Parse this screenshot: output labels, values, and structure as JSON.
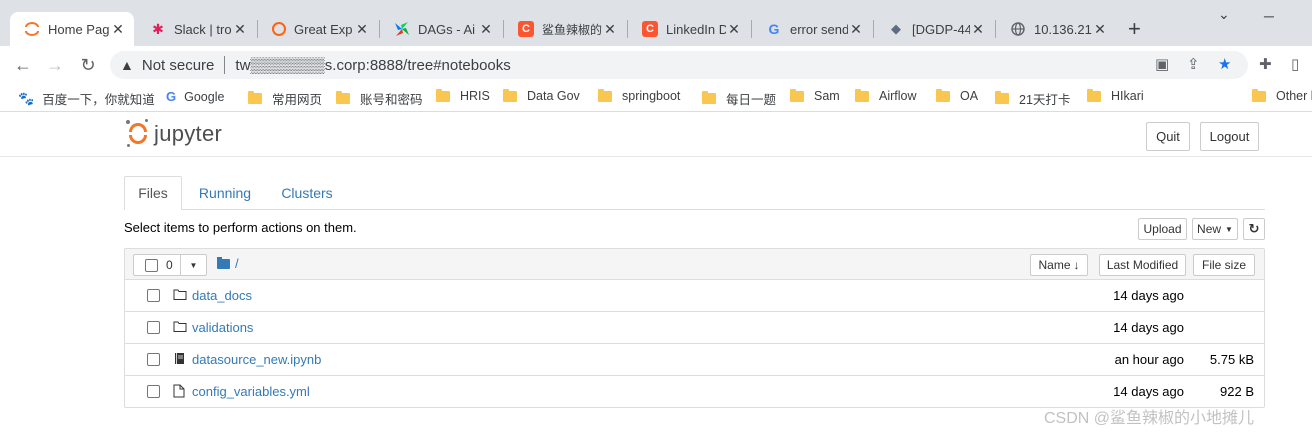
{
  "browser": {
    "tabs": [
      {
        "title": "Home Pag",
        "icon": "jupyter-icon",
        "color": "#f37726",
        "active": true
      },
      {
        "title": "Slack | tro",
        "icon": "slack-icon",
        "color": "#e01e5a",
        "active": false
      },
      {
        "title": "Great Exp",
        "icon": "great-expectations-icon",
        "color": "#ff6310",
        "active": false
      },
      {
        "title": "DAGs - Ai",
        "icon": "airflow-icon",
        "color": "#017cee",
        "active": false
      },
      {
        "title": "鲨鱼辣椒的",
        "icon": "csdn-icon",
        "color": "#fc5531",
        "active": false
      },
      {
        "title": "LinkedIn D",
        "icon": "csdn-icon",
        "color": "#fc5531",
        "active": false
      },
      {
        "title": "error send",
        "icon": "google-icon",
        "color": "#4285f4",
        "active": false
      },
      {
        "title": "[DGDP-44",
        "icon": "jira-icon",
        "color": "#5e6c84",
        "active": false
      },
      {
        "title": "10.136.21",
        "icon": "globe-icon",
        "color": "#5f6368",
        "active": false
      }
    ],
    "security_label": "Not securе",
    "url": "tw▒▒▒▒▒▒▒s.corp:8888/tree#notebooks",
    "bookmarks": [
      {
        "label": "百度一下，你就知道",
        "icon": "baidu-icon"
      },
      {
        "label": "Google",
        "icon": "google-icon"
      },
      {
        "label": "常用网页",
        "icon": "folder-icon"
      },
      {
        "label": "账号和密码",
        "icon": "folder-icon"
      },
      {
        "label": "HRIS",
        "icon": "folder-icon"
      },
      {
        "label": "Data Gov",
        "icon": "folder-icon"
      },
      {
        "label": "springboot",
        "icon": "folder-icon"
      },
      {
        "label": "每日一题",
        "icon": "folder-icon"
      },
      {
        "label": "Sam",
        "icon": "folder-icon"
      },
      {
        "label": "Airflow",
        "icon": "folder-icon"
      },
      {
        "label": "OA",
        "icon": "folder-icon"
      },
      {
        "label": "21天打卡",
        "icon": "folder-icon"
      },
      {
        "label": "HIkari",
        "icon": "folder-icon"
      },
      {
        "label": "Other b",
        "icon": "folder-icon"
      }
    ]
  },
  "jupyter": {
    "logo_text": "jupyter",
    "quit_label": "Quit",
    "logout_label": "Logout",
    "tabs": [
      "Files",
      "Running",
      "Clusters"
    ],
    "hint": "Select items to perform actions on them.",
    "upload_label": "Upload",
    "new_label": "New",
    "selected_count": "0",
    "breadcrumb": "/",
    "columns": {
      "name": "Name",
      "modified": "Last Modified",
      "size": "File size"
    },
    "files": [
      {
        "name": "data_docs",
        "type": "folder",
        "modified": "14 days ago",
        "size": ""
      },
      {
        "name": "validations",
        "type": "folder",
        "modified": "14 days ago",
        "size": ""
      },
      {
        "name": "datasource_new.ipynb",
        "type": "notebook",
        "modified": "an hour ago",
        "size": "5.75 kB"
      },
      {
        "name": "config_variables.yml",
        "type": "file",
        "modified": "14 days ago",
        "size": "922 B"
      }
    ]
  },
  "watermark": "CSDN @鲨鱼辣椒的小地摊儿",
  "colors": {
    "jupyter_orange": "#f37726",
    "link_blue": "#337ab7"
  }
}
